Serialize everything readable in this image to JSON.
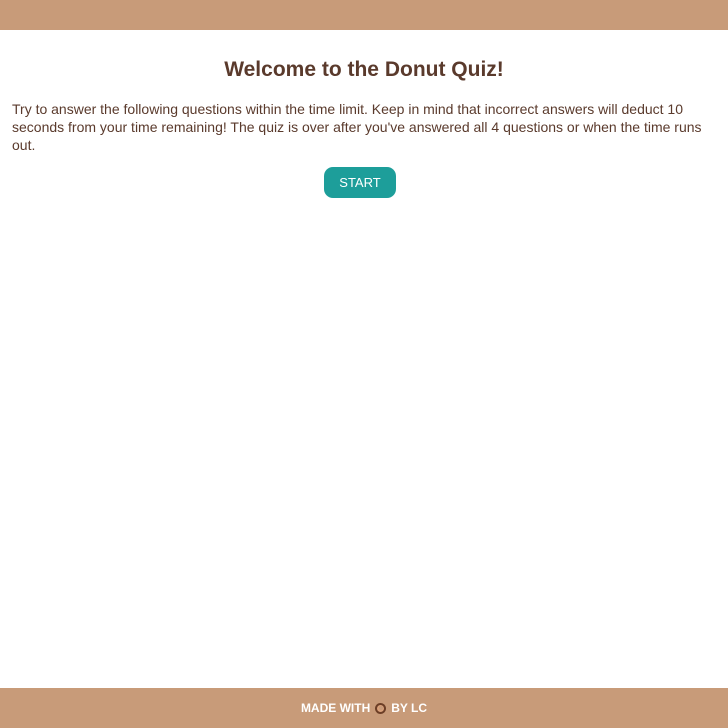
{
  "header": {},
  "quiz": {
    "title": "Welcome to the Donut Quiz!",
    "instructions": "Try to answer the following questions within the time limit. Keep in mind that incorrect answers will deduct 10 seconds from your time remaining! The quiz is over after you've answered all 4 questions or when the time runs out.",
    "start_label": "START"
  },
  "footer": {
    "made_with": "MADE WITH",
    "by": "BY LC",
    "icon": "donut-icon"
  },
  "colors": {
    "bar": "#c89b79",
    "text": "#5a3a2c",
    "button": "#1d9e9a"
  }
}
